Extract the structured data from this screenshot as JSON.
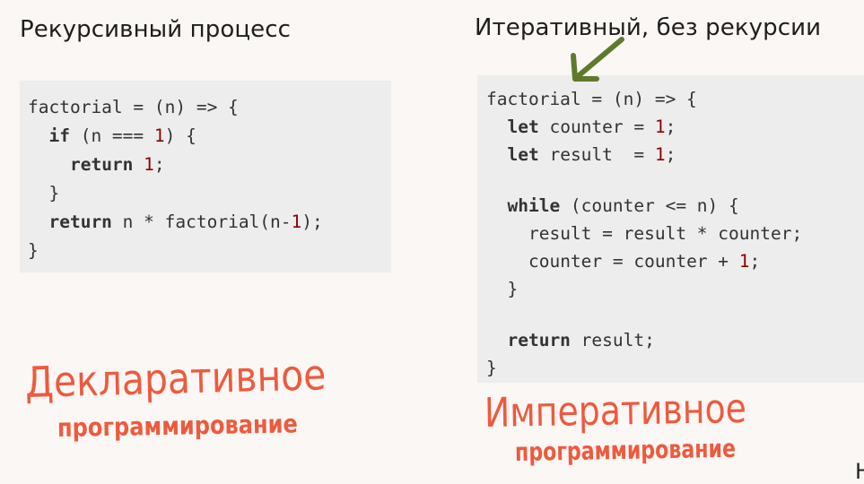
{
  "left": {
    "title": "Рекурсивный процесс",
    "code": {
      "l1": "factorial = (n) => {",
      "l2_kw": "if",
      "l2_a": " (n === ",
      "l2_num": "1",
      "l2_b": ") {",
      "l3_kw": "return",
      "l3_num": "1",
      "l3_b": ";",
      "l4": "}",
      "l5_kw": "return",
      "l5_a": " n * factorial(n-",
      "l5_num": "1",
      "l5_b": ");",
      "l6": "}"
    },
    "handwritten": [
      "Декларативное",
      "программирование"
    ]
  },
  "right": {
    "title": "Итеративный, без рекурсии",
    "code": {
      "l1": "factorial = (n) => {",
      "l2_kw": "let",
      "l2_a": " counter = ",
      "l2_num": "1",
      "l2_b": ";",
      "l3_kw": "let",
      "l3_a": " result  = ",
      "l3_num": "1",
      "l3_b": ";",
      "l4_kw": "while",
      "l4_a": " (counter <= n) {",
      "l5": "result = result * counter;",
      "l6_a": "counter = counter + ",
      "l6_num": "1",
      "l6_b": ";",
      "l7": "}",
      "l8_kw": "return",
      "l8_a": " result;",
      "l9": "}"
    },
    "handwritten": [
      "Императивное",
      "программирование"
    ]
  },
  "corner_glyph": "Н",
  "colors": {
    "handwritten": "#ee5a3e",
    "arrow": "#5e7a2c",
    "number": "#8b0000",
    "code_bg": "#ededed",
    "page_bg": "#faf7f4"
  },
  "icons": [
    "arrow-annotation-icon"
  ]
}
